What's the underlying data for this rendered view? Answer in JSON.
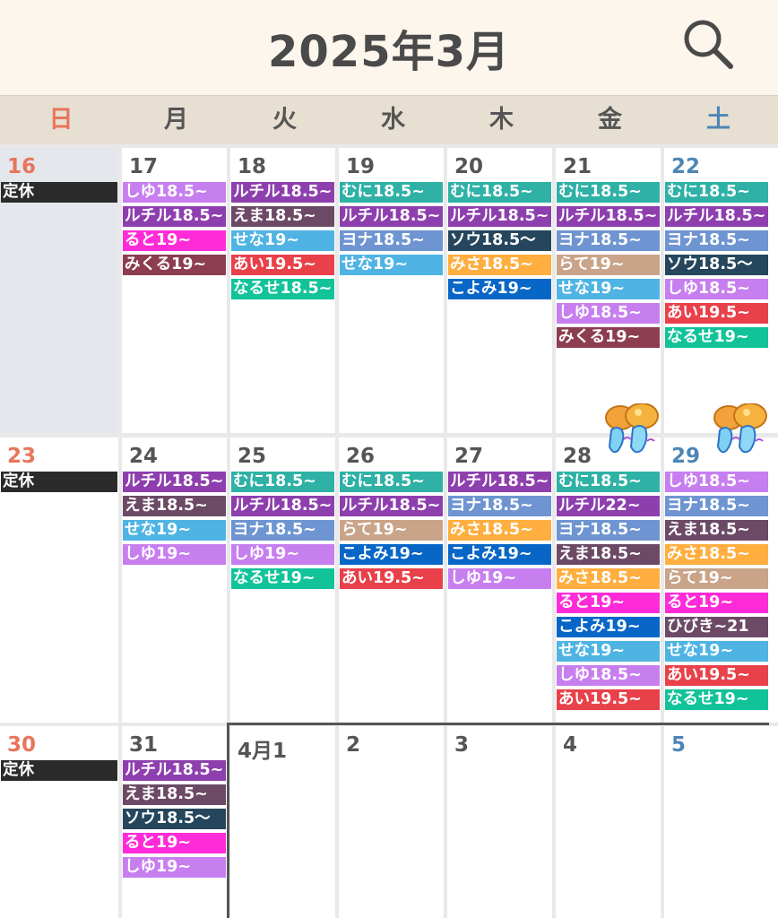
{
  "header": {
    "title": "2025年3月"
  },
  "weekdays": [
    "日",
    "月",
    "火",
    "水",
    "木",
    "金",
    "土"
  ],
  "colors": {
    "purple_light": "#c77ff0",
    "purple_dark": "#8e3fae",
    "plum": "#6c4a66",
    "magenta": "#ff2bd8",
    "maroon": "#8c3d50",
    "teal": "#2fb1a6",
    "slate_blue": "#6e95d1",
    "sky": "#4fb4e3",
    "navy": "#25465c",
    "orange": "#ffae3f",
    "royal": "#0866c7",
    "tan": "#c9a488",
    "red": "#e8414a",
    "green": "#12c39a",
    "holiday": "#2b2b2b"
  },
  "weeks": [
    {
      "days": [
        {
          "num": "16",
          "holiday": true,
          "events": [
            {
              "t": "定休",
              "c": "holiday"
            }
          ]
        },
        {
          "num": "17",
          "events": [
            {
              "t": "しゆ18.5~",
              "c": "purple_light"
            },
            {
              "t": "ルチル18.5~",
              "c": "purple_dark"
            },
            {
              "t": "ると19~",
              "c": "magenta"
            },
            {
              "t": "みくる19~",
              "c": "maroon"
            }
          ]
        },
        {
          "num": "18",
          "events": [
            {
              "t": "ルチル18.5~",
              "c": "purple_dark"
            },
            {
              "t": "えま18.5~",
              "c": "plum"
            },
            {
              "t": "せな19~",
              "c": "sky"
            },
            {
              "t": "あい19.5~",
              "c": "red"
            },
            {
              "t": "なるせ18.5~",
              "c": "green"
            }
          ]
        },
        {
          "num": "19",
          "events": [
            {
              "t": "むに18.5~",
              "c": "teal"
            },
            {
              "t": "ルチル18.5~",
              "c": "purple_dark"
            },
            {
              "t": "ヨナ18.5~",
              "c": "slate_blue"
            },
            {
              "t": "せな19~",
              "c": "sky"
            }
          ]
        },
        {
          "num": "20",
          "events": [
            {
              "t": "むに18.5~",
              "c": "teal"
            },
            {
              "t": "ルチル18.5~",
              "c": "purple_dark"
            },
            {
              "t": "ソウ18.5～",
              "c": "navy"
            },
            {
              "t": "みさ18.5~",
              "c": "orange"
            },
            {
              "t": "こよみ19~",
              "c": "royal"
            }
          ]
        },
        {
          "num": "21",
          "events": [
            {
              "t": "むに18.5~",
              "c": "teal"
            },
            {
              "t": "ルチル18.5~",
              "c": "purple_dark"
            },
            {
              "t": "ヨナ18.5~",
              "c": "slate_blue"
            },
            {
              "t": "らて19~",
              "c": "tan"
            },
            {
              "t": "せな19~",
              "c": "sky"
            },
            {
              "t": "しゆ18.5~",
              "c": "purple_light"
            },
            {
              "t": "みくる19~",
              "c": "maroon"
            }
          ]
        },
        {
          "num": "22",
          "events": [
            {
              "t": "むに18.5~",
              "c": "teal"
            },
            {
              "t": "ルチル18.5~",
              "c": "purple_dark"
            },
            {
              "t": "ヨナ18.5~",
              "c": "slate_blue"
            },
            {
              "t": "ソウ18.5～",
              "c": "navy"
            },
            {
              "t": "しゆ18.5~",
              "c": "purple_light"
            },
            {
              "t": "あい19.5~",
              "c": "red"
            },
            {
              "t": "なるせ19~",
              "c": "green"
            }
          ]
        }
      ]
    },
    {
      "days": [
        {
          "num": "23",
          "events": [
            {
              "t": "定休",
              "c": "holiday"
            }
          ]
        },
        {
          "num": "24",
          "events": [
            {
              "t": "ルチル18.5~",
              "c": "purple_dark"
            },
            {
              "t": "えま18.5~",
              "c": "plum"
            },
            {
              "t": "せな19~",
              "c": "sky"
            },
            {
              "t": "しゆ19~",
              "c": "purple_light"
            }
          ]
        },
        {
          "num": "25",
          "events": [
            {
              "t": "むに18.5~",
              "c": "teal"
            },
            {
              "t": "ルチル18.5~",
              "c": "purple_dark"
            },
            {
              "t": "ヨナ18.5~",
              "c": "slate_blue"
            },
            {
              "t": "しゆ19~",
              "c": "purple_light"
            },
            {
              "t": "なるせ19~",
              "c": "green"
            }
          ]
        },
        {
          "num": "26",
          "events": [
            {
              "t": "むに18.5~",
              "c": "teal"
            },
            {
              "t": "ルチル18.5~",
              "c": "purple_dark"
            },
            {
              "t": "らて19~",
              "c": "tan"
            },
            {
              "t": "こよみ19~",
              "c": "royal"
            },
            {
              "t": "あい19.5~",
              "c": "red"
            }
          ]
        },
        {
          "num": "27",
          "events": [
            {
              "t": "ルチル18.5~",
              "c": "purple_dark"
            },
            {
              "t": "ヨナ18.5~",
              "c": "slate_blue"
            },
            {
              "t": "みさ18.5~",
              "c": "orange"
            },
            {
              "t": "こよみ19~",
              "c": "royal"
            },
            {
              "t": "しゆ19~",
              "c": "purple_light"
            }
          ]
        },
        {
          "num": "28",
          "deco": true,
          "events": [
            {
              "t": "むに18.5~",
              "c": "teal"
            },
            {
              "t": "ルチル22~",
              "c": "purple_dark"
            },
            {
              "t": "ヨナ18.5~",
              "c": "slate_blue"
            },
            {
              "t": "えま18.5~",
              "c": "plum"
            },
            {
              "t": "みさ18.5~",
              "c": "orange"
            },
            {
              "t": "ると19~",
              "c": "magenta"
            },
            {
              "t": "こよみ19~",
              "c": "royal"
            },
            {
              "t": "せな19~",
              "c": "sky"
            },
            {
              "t": "しゆ18.5~",
              "c": "purple_light"
            },
            {
              "t": "あい19.5~",
              "c": "red"
            }
          ]
        },
        {
          "num": "29",
          "deco": true,
          "events": [
            {
              "t": "しゆ18.5~",
              "c": "purple_light"
            },
            {
              "t": "ヨナ18.5~",
              "c": "slate_blue"
            },
            {
              "t": "えま18.5~",
              "c": "plum"
            },
            {
              "t": "みさ18.5~",
              "c": "orange"
            },
            {
              "t": "らて19~",
              "c": "tan"
            },
            {
              "t": "ると19~",
              "c": "magenta"
            },
            {
              "t": "ひびき~21",
              "c": "plum"
            },
            {
              "t": "せな19~",
              "c": "sky"
            },
            {
              "t": "あい19.5~",
              "c": "red"
            },
            {
              "t": "なるせ19~",
              "c": "green"
            }
          ]
        }
      ]
    },
    {
      "days": [
        {
          "num": "30",
          "events": [
            {
              "t": "定休",
              "c": "holiday"
            }
          ]
        },
        {
          "num": "31",
          "events": [
            {
              "t": "ルチル18.5~",
              "c": "purple_dark"
            },
            {
              "t": "えま18.5~",
              "c": "plum"
            },
            {
              "t": "ソウ18.5～",
              "c": "navy"
            },
            {
              "t": "ると19~",
              "c": "magenta"
            },
            {
              "t": "しゆ19~",
              "c": "purple_light"
            }
          ]
        },
        {
          "num": "4月1",
          "events": []
        },
        {
          "num": "2",
          "events": []
        },
        {
          "num": "3",
          "events": []
        },
        {
          "num": "4",
          "events": []
        },
        {
          "num": "5",
          "events": []
        }
      ]
    }
  ]
}
